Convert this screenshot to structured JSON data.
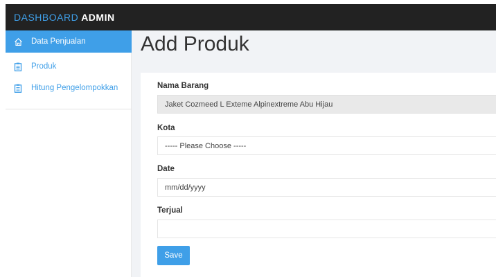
{
  "header": {
    "brand_part1": "DASHBOARD",
    "brand_part2": "ADMIN"
  },
  "sidebar": {
    "items": [
      {
        "label": "Data Penjualan",
        "icon": "home-icon",
        "active": true
      },
      {
        "label": "Produk",
        "icon": "clipboard-icon",
        "active": false
      },
      {
        "label": "Hitung Pengelompokkan",
        "icon": "clipboard-icon",
        "active": false
      }
    ]
  },
  "main": {
    "title": "Add Produk",
    "form": {
      "nama_barang": {
        "label": "Nama Barang",
        "value": "Jaket Cozmeed L Exteme Alpinextreme Abu Hijau"
      },
      "kota": {
        "label": "Kota",
        "value": "----- Please Choose -----"
      },
      "date": {
        "label": "Date",
        "placeholder": "mm/dd/yyyy"
      },
      "terjual": {
        "label": "Terjual",
        "value": ""
      },
      "save_label": "Save"
    }
  },
  "colors": {
    "accent": "#3f9fe8",
    "topbar": "#222222",
    "background": "#f1f3f6"
  }
}
